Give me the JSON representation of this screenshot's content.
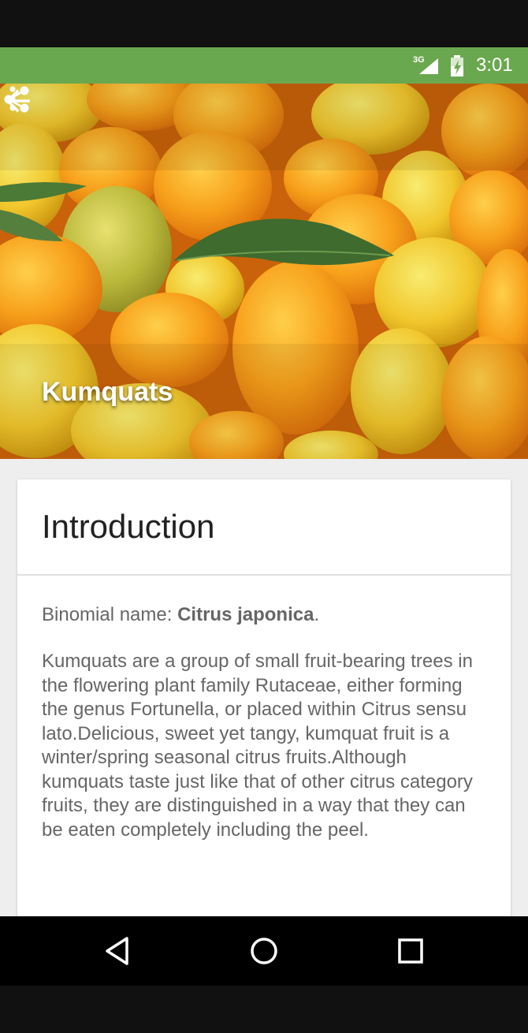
{
  "status_bar": {
    "network": "3G",
    "time": "3:01",
    "color": "#6aa84f"
  },
  "toolbar": {
    "back_icon": "arrow-back-icon",
    "share_icon": "share-icon",
    "more_icon": "more-vert-icon"
  },
  "hero": {
    "title": "Kumquats",
    "image": "kumquat-fruits-photo"
  },
  "card": {
    "title": "Introduction",
    "binomial_label": "Binomial name: ",
    "binomial_value": "Citrus japonica",
    "binomial_suffix": ".",
    "description": "Kumquats are a group of small fruit-bearing trees in the flowering plant family Rutaceae, either forming the genus Fortunella, or placed within Citrus sensu lato.Delicious, sweet yet tangy, kumquat fruit is a winter/spring seasonal citrus fruits.Although kumquats taste just like that of other citrus category fruits, they are distinguished in a way that they can be eaten completely including the peel."
  },
  "nav_bar": {
    "back_icon": "nav-back-icon",
    "home_icon": "nav-home-icon",
    "recents_icon": "nav-recents-icon"
  }
}
